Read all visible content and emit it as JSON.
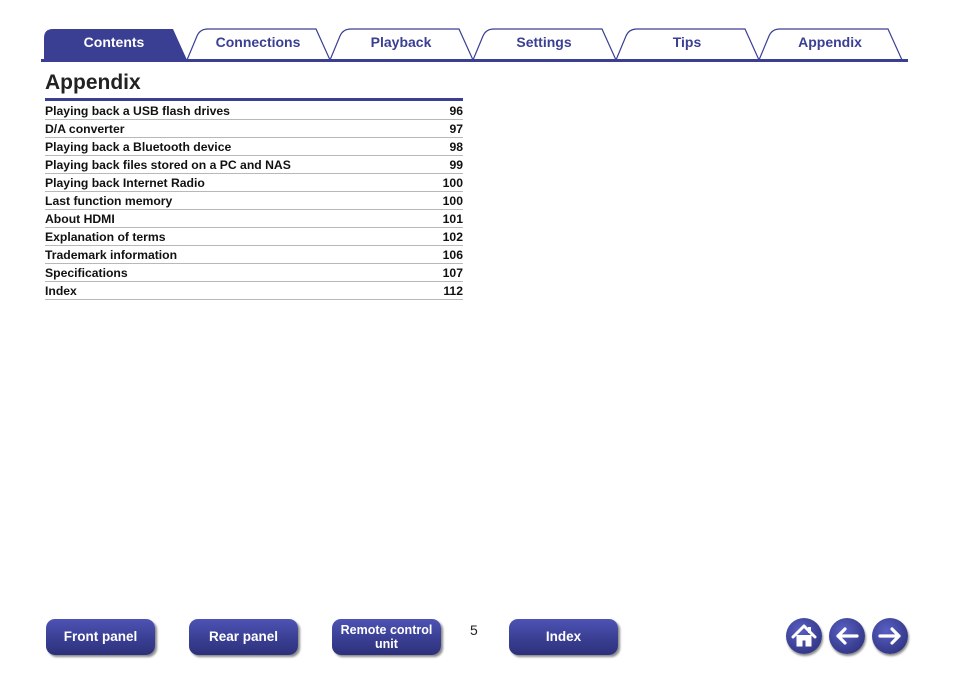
{
  "tabs": [
    {
      "label": "Contents",
      "active": true
    },
    {
      "label": "Connections",
      "active": false
    },
    {
      "label": "Playback",
      "active": false
    },
    {
      "label": "Settings",
      "active": false
    },
    {
      "label": "Tips",
      "active": false
    },
    {
      "label": "Appendix",
      "active": false
    }
  ],
  "title": "Appendix",
  "toc": [
    {
      "label": "Playing back a USB flash drives",
      "page": "96"
    },
    {
      "label": "D/A converter",
      "page": "97"
    },
    {
      "label": "Playing back a Bluetooth device",
      "page": "98"
    },
    {
      "label": "Playing back files stored on a PC and NAS",
      "page": "99"
    },
    {
      "label": "Playing back Internet Radio",
      "page": "100"
    },
    {
      "label": "Last function memory",
      "page": "100"
    },
    {
      "label": "About HDMI",
      "page": "101"
    },
    {
      "label": "Explanation of terms",
      "page": "102"
    },
    {
      "label": "Trademark information",
      "page": "106"
    },
    {
      "label": "Specifications",
      "page": "107"
    },
    {
      "label": "Index",
      "page": "112"
    }
  ],
  "footer": {
    "front_panel": "Front panel",
    "rear_panel": "Rear panel",
    "remote_line1": "Remote control",
    "remote_line2": "unit",
    "page_number": "5",
    "index": "Index",
    "icons": [
      "home-icon",
      "back-arrow-icon",
      "forward-arrow-icon"
    ]
  },
  "colors": {
    "accent": "#3a3f93",
    "rule": "#b8b8b8"
  }
}
